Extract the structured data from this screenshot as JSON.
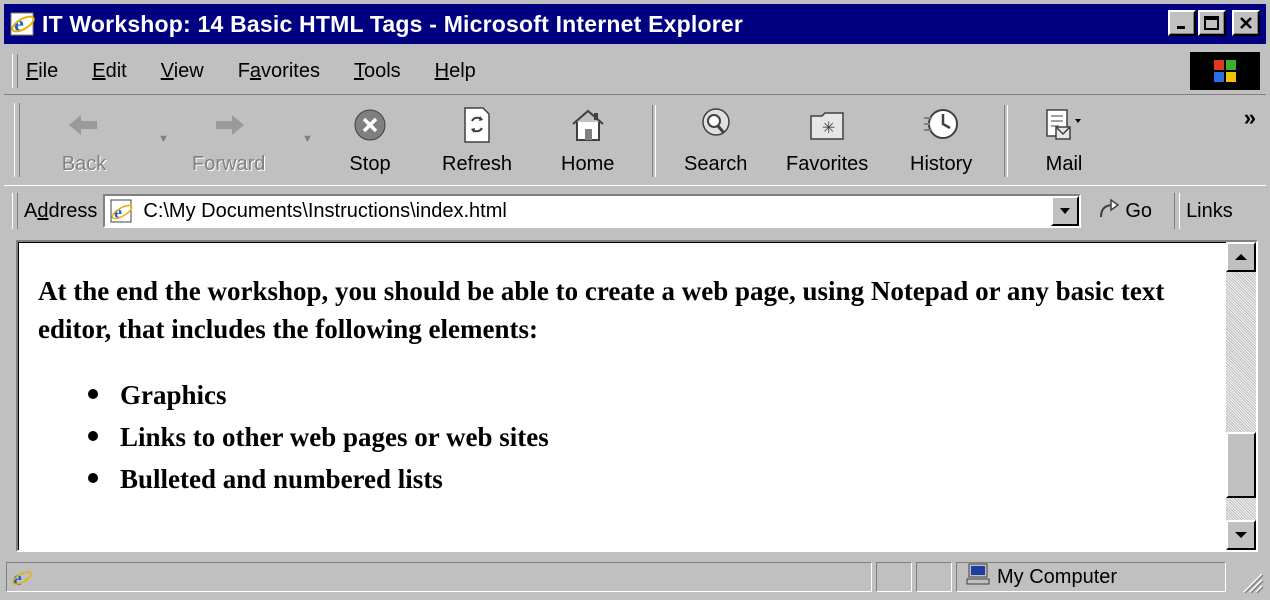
{
  "window": {
    "title": "IT Workshop: 14 Basic HTML Tags - Microsoft Internet Explorer",
    "buttons": {
      "minimize": "_",
      "maximize": "□",
      "close": "×"
    }
  },
  "menubar": {
    "items": [
      {
        "pre": "",
        "u": "F",
        "post": "ile"
      },
      {
        "pre": "",
        "u": "E",
        "post": "dit"
      },
      {
        "pre": "",
        "u": "V",
        "post": "iew"
      },
      {
        "pre": "F",
        "u": "a",
        "post": "vorites"
      },
      {
        "pre": "",
        "u": "T",
        "post": "ools"
      },
      {
        "pre": "",
        "u": "H",
        "post": "elp"
      }
    ]
  },
  "toolbar": {
    "back": "Back",
    "forward": "Forward",
    "stop": "Stop",
    "refresh": "Refresh",
    "home": "Home",
    "search": "Search",
    "favorites": "Favorites",
    "history": "History",
    "mail": "Mail",
    "more": "»"
  },
  "address": {
    "label_pre": "A",
    "label_u": "d",
    "label_post": "dress",
    "url": "C:\\My Documents\\Instructions\\index.html",
    "go": "Go",
    "links": "Links"
  },
  "content": {
    "intro": "At the end the workshop, you should be able to create a web page, using Notepad or any basic text editor, that includes the following elements:",
    "bullets": [
      "Graphics",
      "Links to other web pages or web sites",
      "Bulleted and numbered lists"
    ]
  },
  "status": {
    "zone": "My Computer"
  },
  "colors": {
    "titlebar": "#000080",
    "chrome": "#c0c0c0",
    "content_bg": "#ffffff"
  },
  "icons": {
    "app": "ie-logo-icon",
    "back": "back-arrow-icon",
    "forward": "forward-arrow-icon",
    "stop": "stop-icon",
    "refresh": "refresh-icon",
    "home": "home-icon",
    "search": "search-icon",
    "favorites": "favorites-folder-icon",
    "history": "history-icon",
    "mail": "mail-icon",
    "go": "go-arrow-icon",
    "computer": "my-computer-icon"
  }
}
